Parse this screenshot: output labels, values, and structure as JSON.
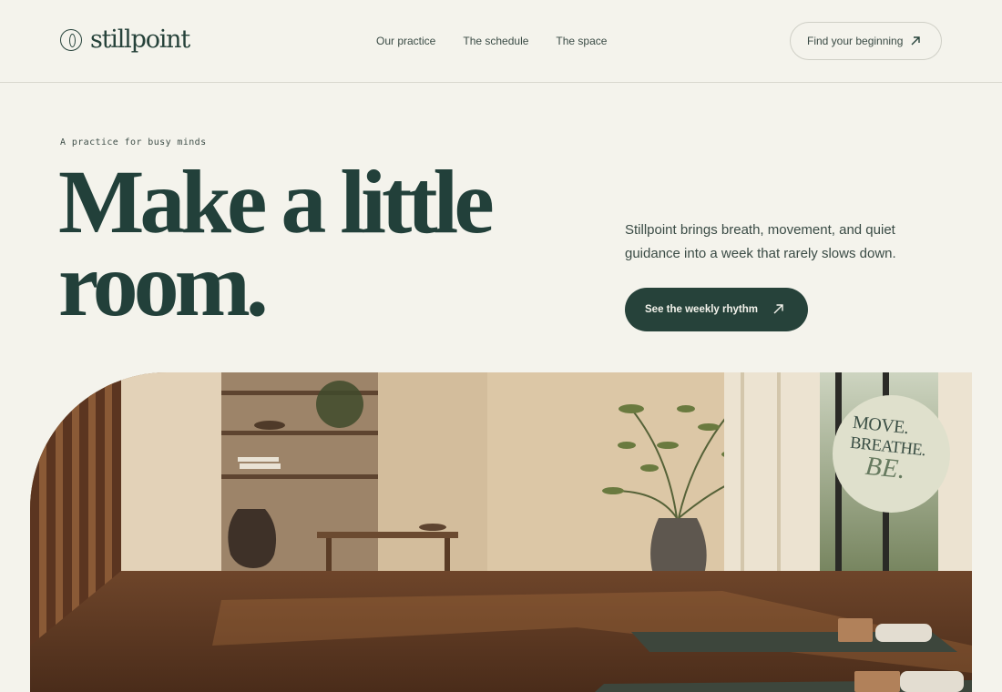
{
  "brand": {
    "name": "stillpoint",
    "icon": "seed-circle-icon"
  },
  "nav": {
    "items": [
      {
        "label": "Our practice"
      },
      {
        "label": "The schedule"
      },
      {
        "label": "The space"
      }
    ],
    "cta_label": "Find your beginning",
    "cta_icon": "arrow-up-right-icon"
  },
  "hero": {
    "eyebrow": "A practice for busy minds",
    "headline_line1": "Make a little",
    "headline_line2": "room.",
    "lede": "Stillpoint brings breath, movement, and quiet guidance into a week that rarely slows down.",
    "cta_label": "See the weekly rhythm",
    "cta_icon": "arrow-up-right-icon"
  },
  "badge": {
    "line1": "MOVE.",
    "line2": "BREATHE.",
    "line3": "BE."
  },
  "colors": {
    "background": "#f4f3ec",
    "accent": "#26423a",
    "badge": "#dfe0cc"
  }
}
